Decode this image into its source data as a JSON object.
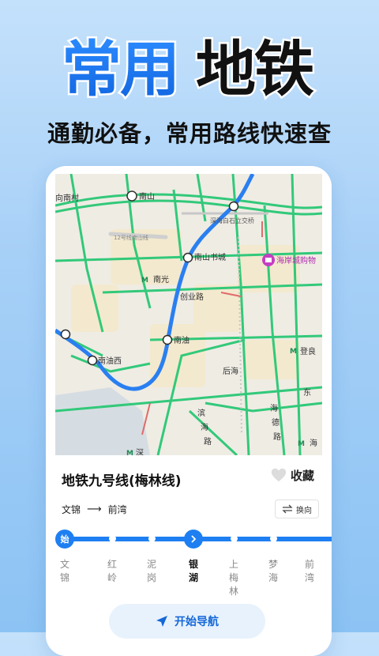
{
  "hero": {
    "title": "常用地铁",
    "subtitle": "通勤必备，常用路线快速查"
  },
  "colors": {
    "accent": "#1e7ff2",
    "route": "#2a7ff0",
    "road_green": "#32c97a",
    "title_blue": "#1a78f2",
    "background": "#a9d2f7"
  },
  "map": {
    "labels": {
      "nancun": "向南村",
      "nanshan": "南山",
      "road12": "12号线南山线",
      "interchange": "深海白石立交桥",
      "bookcity": "南山书城",
      "mall": "海岸城购物",
      "nanguang": "南光",
      "chuangye": "创业路",
      "nanyou": "南油",
      "nanyouxi": "南油西",
      "dengliang": "登良",
      "houhai": "后海",
      "houhai_road1": "海",
      "houhai_road2": "德",
      "houhai_road3": "路",
      "binhai": "滨",
      "binhai2": "海",
      "binhai3": "路",
      "dong": "东",
      "hai": "海",
      "shen": "深"
    }
  },
  "line": {
    "name": "地铁九号线(梅林线)",
    "favorite_label": "收藏",
    "from": "文锦",
    "arrow": "⟶",
    "to": "前湾",
    "switch_label": "换向",
    "start_badge": "始",
    "stations": [
      "文锦",
      "红岭",
      "泥岗",
      "银湖",
      "上梅林",
      "梦海",
      "前湾"
    ],
    "current_index": 3,
    "navigate_label": "开始导航"
  }
}
